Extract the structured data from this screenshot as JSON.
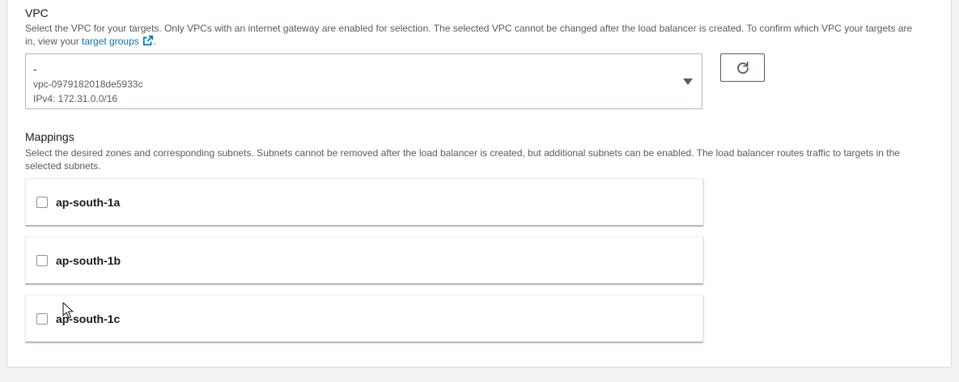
{
  "vpc": {
    "title": "VPC",
    "description_before_link": "Select the VPC for your targets. Only VPCs with an internet gateway are enabled for selection. The selected VPC cannot be changed after the load balancer is created. To confirm which VPC your targets are in, view your ",
    "link_text": "target groups",
    "description_after_link": ".",
    "selected": {
      "name": "-",
      "id": "vpc-0979182018de5933c",
      "cidr": "IPv4: 172.31.0.0/16"
    }
  },
  "mappings": {
    "title": "Mappings",
    "description": "Select the desired zones and corresponding subnets. Subnets cannot be removed after the load balancer is created, but additional subnets can be enabled. The load balancer routes traffic to targets in the selected subnets.",
    "zones": [
      {
        "label": "ap-south-1a",
        "checked": false
      },
      {
        "label": "ap-south-1b",
        "checked": false
      },
      {
        "label": "ap-south-1c",
        "checked": false
      }
    ]
  },
  "colors": {
    "link": "#0073bb",
    "text": "#16191f",
    "secondary_text": "#545b64",
    "border": "#aab7b8",
    "background": "#f2f3f3"
  },
  "icons": [
    "external-link-icon",
    "refresh-icon",
    "caret-down-icon",
    "mouse-cursor-icon"
  ]
}
